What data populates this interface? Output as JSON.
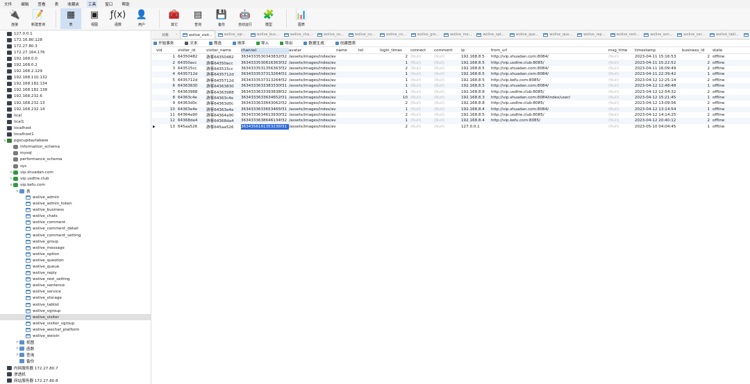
{
  "menu": [
    "文件",
    "编辑",
    "查看",
    "表",
    "收藏夹",
    "工具",
    "窗口",
    "帮助"
  ],
  "toolbar": {
    "buttons": [
      {
        "label": "连接",
        "icon": "connect-icon",
        "glyph": "🔌"
      },
      {
        "label": "新建查询",
        "icon": "new-query-icon",
        "glyph": "📝"
      },
      {
        "label": "表",
        "icon": "table-icon",
        "glyph": "▦"
      },
      {
        "label": "视图",
        "icon": "view-icon",
        "glyph": "▣"
      },
      {
        "label": "函数",
        "icon": "function-icon",
        "glyph": "ƒ(x)"
      },
      {
        "label": "用户",
        "icon": "user-icon",
        "glyph": "👤"
      },
      {
        "label": "其它",
        "icon": "other-icon",
        "glyph": "🧰"
      },
      {
        "label": "查询",
        "icon": "query-icon",
        "glyph": "▤"
      },
      {
        "label": "备份",
        "icon": "backup-icon",
        "glyph": "💾"
      },
      {
        "label": "自动运行",
        "icon": "automation-icon",
        "glyph": "🤖"
      },
      {
        "label": "模型",
        "icon": "model-icon",
        "glyph": "🧩"
      },
      {
        "label": "图表",
        "icon": "chart-icon",
        "glyph": "📊"
      }
    ]
  },
  "sidebar": {
    "items": [
      {
        "label": "127.0.0.1",
        "type": "server",
        "level": 0
      },
      {
        "label": "172.16.80.128",
        "type": "server",
        "level": 0
      },
      {
        "label": "172.27.80.3",
        "type": "server",
        "level": 0
      },
      {
        "label": "172.27.164.176",
        "type": "server",
        "level": 0
      },
      {
        "label": "192.168.0.0",
        "type": "server",
        "level": 0
      },
      {
        "label": "192.168.0.2",
        "type": "server",
        "level": 0
      },
      {
        "label": "192.168.2.129",
        "type": "server",
        "level": 0
      },
      {
        "label": "192.168.110.132",
        "type": "server",
        "level": 0
      },
      {
        "label": "192.168.182.134",
        "type": "server",
        "level": 0
      },
      {
        "label": "192.168.182.138",
        "type": "server",
        "level": 0
      },
      {
        "label": "192.168.232.6",
        "type": "server",
        "level": 0
      },
      {
        "label": "192.168.232.13",
        "type": "server",
        "level": 0
      },
      {
        "label": "192.168.232.14",
        "type": "server",
        "level": 0
      },
      {
        "label": "lical",
        "type": "server",
        "level": 0
      },
      {
        "label": "lical1",
        "type": "server",
        "level": 0
      },
      {
        "label": "localhost",
        "type": "server",
        "level": 0
      },
      {
        "label": "localhost1",
        "type": "server",
        "level": 0
      },
      {
        "label": "pgscupdaytabase",
        "type": "server-open",
        "level": 0,
        "arrow": "∨"
      },
      {
        "label": "information_schema",
        "type": "db",
        "level": 1
      },
      {
        "label": "mysql",
        "type": "db",
        "level": 1
      },
      {
        "label": "performance_schema",
        "type": "db",
        "level": 1
      },
      {
        "label": "sys",
        "type": "db",
        "level": 1
      },
      {
        "label": "vip.shuadan.com",
        "type": "dbg",
        "level": 1,
        "arrow": ">"
      },
      {
        "label": "vip.usdtre.club",
        "type": "dbg",
        "level": 1,
        "arrow": ">"
      },
      {
        "label": "vip.kefu.com",
        "type": "dbg",
        "level": 1,
        "arrow": "∨"
      },
      {
        "label": "表",
        "type": "folder",
        "level": 2,
        "arrow": "∨"
      },
      {
        "label": "wolive_admin",
        "type": "table",
        "level": 3
      },
      {
        "label": "wolive_admin_token",
        "type": "table",
        "level": 3
      },
      {
        "label": "wolive_business",
        "type": "table",
        "level": 3
      },
      {
        "label": "wolive_chats",
        "type": "table",
        "level": 3
      },
      {
        "label": "wolive_comment",
        "type": "table",
        "level": 3
      },
      {
        "label": "wolive_comment_detail",
        "type": "table",
        "level": 3
      },
      {
        "label": "wolive_comment_setting",
        "type": "table",
        "level": 3
      },
      {
        "label": "wolive_group",
        "type": "table",
        "level": 3
      },
      {
        "label": "wolive_message",
        "type": "table",
        "level": 3
      },
      {
        "label": "wolive_option",
        "type": "table",
        "level": 3
      },
      {
        "label": "wolive_question",
        "type": "table",
        "level": 3
      },
      {
        "label": "wolive_queue",
        "type": "table",
        "level": 3
      },
      {
        "label": "wolive_reply",
        "type": "table",
        "level": 3
      },
      {
        "label": "wolive_rest_setting",
        "type": "table",
        "level": 3
      },
      {
        "label": "wolive_sentence",
        "type": "table",
        "level": 3
      },
      {
        "label": "wolive_service",
        "type": "table",
        "level": 3
      },
      {
        "label": "wolive_storage",
        "type": "table",
        "level": 3
      },
      {
        "label": "wolive_tablist",
        "type": "table",
        "level": 3
      },
      {
        "label": "wolive_vgroup",
        "type": "table",
        "level": 3
      },
      {
        "label": "wolive_visiter",
        "type": "table",
        "level": 3,
        "selected": true
      },
      {
        "label": "wolive_visiter_vgroup",
        "type": "table",
        "level": 3
      },
      {
        "label": "wolive_wechat_platform",
        "type": "table",
        "level": 3
      },
      {
        "label": "wolive_weixin",
        "type": "table",
        "level": 3
      },
      {
        "label": "视图",
        "type": "folder",
        "level": 2,
        "arrow": ">"
      },
      {
        "label": "函数",
        "type": "folder",
        "level": 2,
        "arrow": ">"
      },
      {
        "label": "查询",
        "type": "folder",
        "level": 2,
        "arrow": ">"
      },
      {
        "label": "备份",
        "type": "folder",
        "level": 2
      },
      {
        "label": "内网服务器 172.27.80.7",
        "type": "server",
        "level": 0
      },
      {
        "label": "渗透机",
        "type": "server",
        "level": 0
      },
      {
        "label": "网站服务器 172.27.80.8",
        "type": "server",
        "level": 0
      }
    ]
  },
  "tabs": {
    "object_label": "对象",
    "items": [
      "wolive_visit...",
      "wolive_vgr...",
      "wolive_bus...",
      "wolive_cha...",
      "wolive_co...",
      "wolive_co...",
      "wolive_co...",
      "wolive_gro...",
      "wolive_me...",
      "wolive_opt...",
      "wolive_que...",
      "wolive_que...",
      "wolive_rep...",
      "wolive_rest...",
      "wolive_sen...",
      "wolive_ser...",
      "wolive_tabl...",
      "wolive_visit..."
    ]
  },
  "actions": [
    "开始事务",
    "文本",
    "筛选",
    "排序",
    "导入",
    "导出",
    "数据生成",
    "创建图表"
  ],
  "table": {
    "columns": [
      "vid",
      "visiter_id",
      "visiter_name",
      "channel",
      "avatar",
      "name",
      "tel",
      "login_times",
      "connect",
      "comment",
      "ip",
      "from_url",
      "msg_time",
      "timestamp",
      "business_id",
      "state"
    ],
    "rows": [
      [
        "1",
        "64350482",
        "游客64350482",
        "3634333530343832f32",
        "/assets/images/index/ava",
        "",
        "",
        "2",
        "(Null)",
        "(Null)",
        "192.168.8.5",
        "http://vip.shuadan.com:8084/",
        "(Null)",
        "2023-04-11 15:16:53",
        "2",
        "offline"
      ],
      [
        "2",
        "64350acc",
        "游客64350acc",
        "3634333530616363f32",
        "/assets/images/index/ava",
        "",
        "",
        "1",
        "(Null)",
        "(Null)",
        "192.168.8.5",
        "http://vip.usdtre.club:8085/",
        "(Null)",
        "2023-04-11 15:22:52",
        "2",
        "offline"
      ],
      [
        "3",
        "643515cc",
        "游客643515cc",
        "3634333531356363f32",
        "/assets/images/index/ava",
        "",
        "",
        "2",
        "(Null)",
        "(Null)",
        "192.168.8.5",
        "http://vip.shuadan.com:8084/",
        "(Null)",
        "2023-04-11 16:09:49",
        "2",
        "offline"
      ],
      [
        "4",
        "6435712d",
        "游客6435712d",
        "3634333537313264f31",
        "/assets/images/index/ava",
        "",
        "",
        "1",
        "(Null)",
        "(Null)",
        "192.168.8.5",
        "http://vip.shuadan.com:8084/",
        "(Null)",
        "2023-04-11 22:39:42",
        "1",
        "offline"
      ],
      [
        "5",
        "6435712d",
        "游客6435712d",
        "3634333537313264f32",
        "/assets/images/index/ava",
        "",
        "",
        "1",
        "(Null)",
        "(Null)",
        "192.168.8.5",
        "http://vip.kefu.com:8085/",
        "(Null)",
        "2023-04-12 12:25:14",
        "2",
        "offline"
      ],
      [
        "6",
        "64363830",
        "游客64363830",
        "3634333633383330f31",
        "/assets/images/index/ava",
        "",
        "",
        "1",
        "(Null)",
        "(Null)",
        "192.168.8.5",
        "http://vip.shuadan.com:8084/",
        "(Null)",
        "2023-04-12 12:48:48",
        "1",
        "offline"
      ],
      [
        "7",
        "64363988",
        "游客64363988",
        "3634333633393838f32",
        "/assets/images/index/ava",
        "",
        "",
        "1",
        "(Null)",
        "(Null)",
        "192.168.8.8",
        "http://vip.usdtre.club:8085/",
        "(Null)",
        "2023-04-12 12:54:32",
        "2",
        "offline"
      ],
      [
        "8",
        "64363c4e",
        "游客64363c4e",
        "3634333633634652f31",
        "/assets/images/index/ava",
        "",
        "",
        "10",
        "(Null)",
        "(Null)",
        "192.168.8.3",
        "http://vip.shuadan.com:8084/index/user/",
        "(Null)",
        "2023-04-12 15:21:45",
        "1",
        "offline"
      ],
      [
        "9",
        "64363d0c",
        "游客64363d0c",
        "3634333633643062f32",
        "/assets/images/index/ava",
        "",
        "",
        "2",
        "(Null)",
        "(Null)",
        "192.168.8.8",
        "http://vip.usdtre.club:8085/",
        "(Null)",
        "2023-04-12 13:09:56",
        "2",
        "offline"
      ],
      [
        "10",
        "64363e4e",
        "游客64363e4e",
        "3634333633653465f31",
        "/assets/images/index/ava",
        "",
        "",
        "1",
        "(Null)",
        "(Null)",
        "192.168.8.4",
        "http://vip.shuadan.com:8084/",
        "(Null)",
        "2023-04-12 13:14:54",
        "1",
        "offline"
      ],
      [
        "11",
        "64364a90",
        "游客64364a90",
        "3634333634613930f32",
        "/assets/images/index/ava",
        "",
        "",
        "2",
        "(Null)",
        "(Null)",
        "192.168.8.5",
        "http://vip.usdtre.club:8085/",
        "(Null)",
        "2023-04-12 14:14:25",
        "2",
        "offline"
      ],
      [
        "12",
        "64368da4",
        "游客64368da4",
        "3634333638646134f32",
        "/assets/images/index/ava",
        "",
        "",
        "1",
        "(Null)",
        "(Null)",
        "192.168.8.4",
        "http://vip.kefu.com:8085/",
        "(Null)",
        "2023-04-12 20:40:12",
        "2",
        "offline"
      ],
      [
        "13",
        "645aa526",
        "游客645aa526",
        "3634356161353236f31",
        "/assets/images/index/ava",
        "",
        "",
        "2",
        "(Null)",
        "(Null)",
        "127.0.0.1",
        "",
        "(Null)",
        "2023-05-10 04:04:45",
        "1",
        "offline"
      ]
    ],
    "current_row_index": 12,
    "selected_column": "channel"
  },
  "colors": {
    "accent": "#2f6bd6",
    "selection": "#d6e4f6",
    "alt_row": "#f3f6fb"
  }
}
